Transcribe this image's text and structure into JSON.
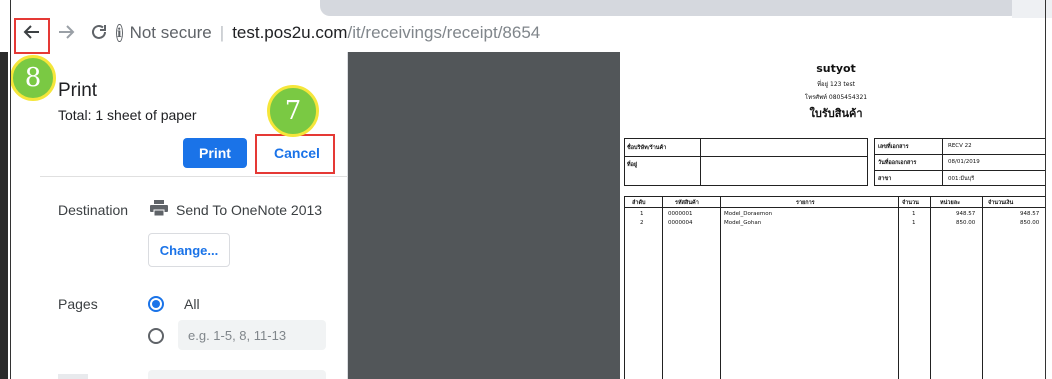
{
  "browser": {
    "security_text": "Not secure",
    "url_host": "test.pos2u.com",
    "url_path": "/it/receivings/receipt/8654"
  },
  "annotations": {
    "step_back": "8",
    "step_cancel": "7",
    "highlight_color": "#e53935"
  },
  "print_panel": {
    "title": "Print",
    "total": "Total: 1 sheet of paper",
    "print_label": "Print",
    "cancel_label": "Cancel",
    "destination_label": "Destination",
    "destination_value": "Send To OneNote 2013",
    "change_label": "Change...",
    "pages_label": "Pages",
    "pages_all": "All",
    "pages_placeholder": "e.g. 1-5, 8, 11-13",
    "accent": "#1a73e8"
  },
  "receipt": {
    "shop_name": "sutyot",
    "address": "ที่อยู่ 123 test",
    "phone": "โทรศัพท์ 0805454321",
    "doc_title": "ใบรับสินค้า",
    "supplier_label": "ชื่อบริษัท/ร้านค้า",
    "address_label": "ที่อยู่",
    "doc_no_label": "เลขที่เอกสาร",
    "doc_no_value": "RECV 22",
    "date_label": "วันที่ออกเอกสาร",
    "date_value": "08/01/2019",
    "branch_label": "สาขา",
    "branch_value": "001:มีนบุรี",
    "columns": [
      "ลำดับ",
      "รหัสสินค้า",
      "รายการ",
      "จำนวน",
      "หน่วยละ",
      "จำนวนเงิน"
    ],
    "rows": [
      [
        "1",
        "0000001",
        "Model_Doraemon",
        "1",
        "948.57",
        "948.57"
      ],
      [
        "2",
        "0000004",
        "Model_Gohan",
        "1",
        "850.00",
        "850.00"
      ]
    ]
  }
}
